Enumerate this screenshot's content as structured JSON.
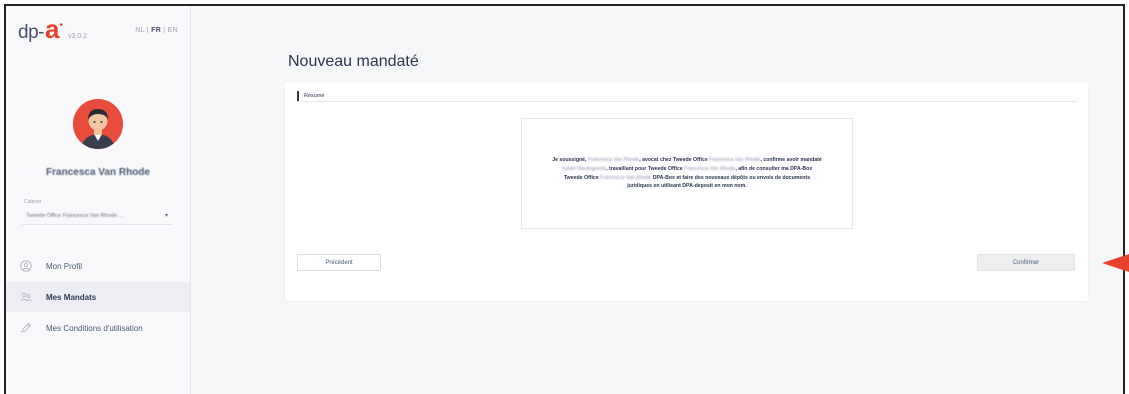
{
  "brand": {
    "logo_dp": "dp-",
    "logo_a": "a",
    "version": "v3.0.2",
    "languages": [
      {
        "label": "NL",
        "active": false
      },
      {
        "label": "FR",
        "active": true
      },
      {
        "label": "EN",
        "active": false
      }
    ],
    "separator": " | ",
    "accent_color": "#e8412b"
  },
  "user": {
    "name": "Francesca Van Rhode",
    "avatar_icon": "user-avatar-icon"
  },
  "cabinet": {
    "label": "Cabinet",
    "value": "Tweede Office Francesca Van Rhode ..."
  },
  "nav": {
    "items": [
      {
        "label": "Mon Profil",
        "icon": "user-circle-icon",
        "active": false
      },
      {
        "label": "Mes Mandats",
        "icon": "users-icon",
        "active": true
      },
      {
        "label": "Mes Conditions d'utilisation",
        "icon": "pen-icon",
        "active": false
      }
    ]
  },
  "page": {
    "title": "Nouveau mandaté",
    "tab_label": "Résumé"
  },
  "summary": {
    "p1": "Je soussigné, ",
    "name1": "Francesca Van Rhode",
    "p2": ", avocat chez Tweede Office ",
    "name2": "Francesca Van Rhode",
    "p3": ", confirme avoir mandaté ",
    "name3": "Sylvie Vandegoede",
    "p4": ", travaillant pour Tweede Office ",
    "name4": "Francesca Van Rhode",
    "p5": ", afin de consulter ma DPA-Box Tweede Office ",
    "name5": "Francesca Van Rhode",
    "p6": " DPA-Box et faire des nouveaux dépôts ou envois de documents juridiques en utilisant DPA-deposit en mon nom."
  },
  "buttons": {
    "previous": "Précédent",
    "confirm": "Confirmer"
  },
  "annotation": {
    "arrow_icon": "pointer-arrow-icon",
    "color": "#e8412b"
  }
}
